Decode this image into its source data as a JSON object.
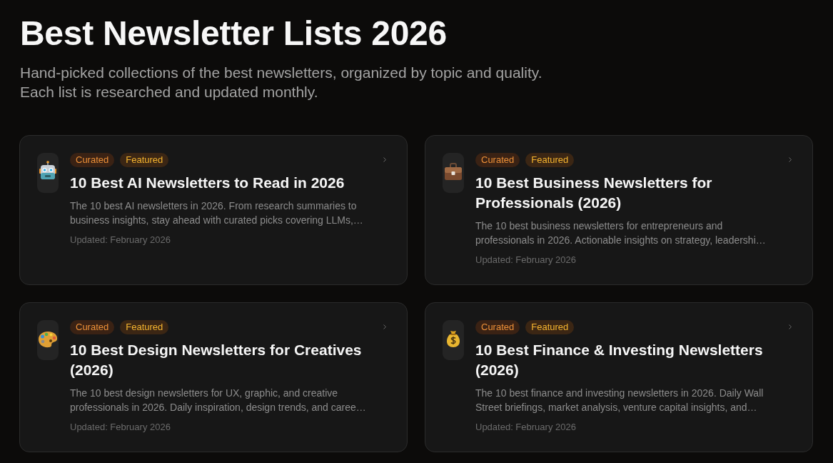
{
  "header": {
    "title": "Best Newsletter Lists 2026",
    "subtitle": "Hand-picked collections of the best newsletters, organized by topic and quality.\nEach list is researched and updated monthly."
  },
  "cards": [
    {
      "tags": [
        {
          "label": "Curated",
          "kind": "curated"
        },
        {
          "label": "Featured",
          "kind": "featured"
        }
      ],
      "title": "10 Best AI Newsletters to Read in 2026",
      "description": "The 10 best AI newsletters in 2026. From research summaries to business insights, stay ahead with curated picks covering LLMs,…",
      "updated": "Updated: February 2026"
    },
    {
      "tags": [
        {
          "label": "Curated",
          "kind": "curated"
        },
        {
          "label": "Featured",
          "kind": "featured"
        }
      ],
      "title": "10 Best Business Newsletters for Professionals (2026)",
      "description": "The 10 best business newsletters for entrepreneurs and professionals in 2026. Actionable insights on strategy, leadershi…",
      "updated": "Updated: February 2026"
    },
    {
      "tags": [
        {
          "label": "Curated",
          "kind": "curated"
        },
        {
          "label": "Featured",
          "kind": "featured"
        }
      ],
      "title": "10 Best Design Newsletters for Creatives (2026)",
      "description": "The 10 best design newsletters for UX, graphic, and creative professionals in 2026. Daily inspiration, design trends, and caree…",
      "updated": "Updated: February 2026"
    },
    {
      "tags": [
        {
          "label": "Curated",
          "kind": "curated"
        },
        {
          "label": "Featured",
          "kind": "featured"
        }
      ],
      "title": "10 Best Finance & Investing Newsletters (2026)",
      "description": "The 10 best finance and investing newsletters in 2026. Daily Wall Street briefings, market analysis, venture capital insights, and…",
      "updated": "Updated: February 2026"
    }
  ]
}
